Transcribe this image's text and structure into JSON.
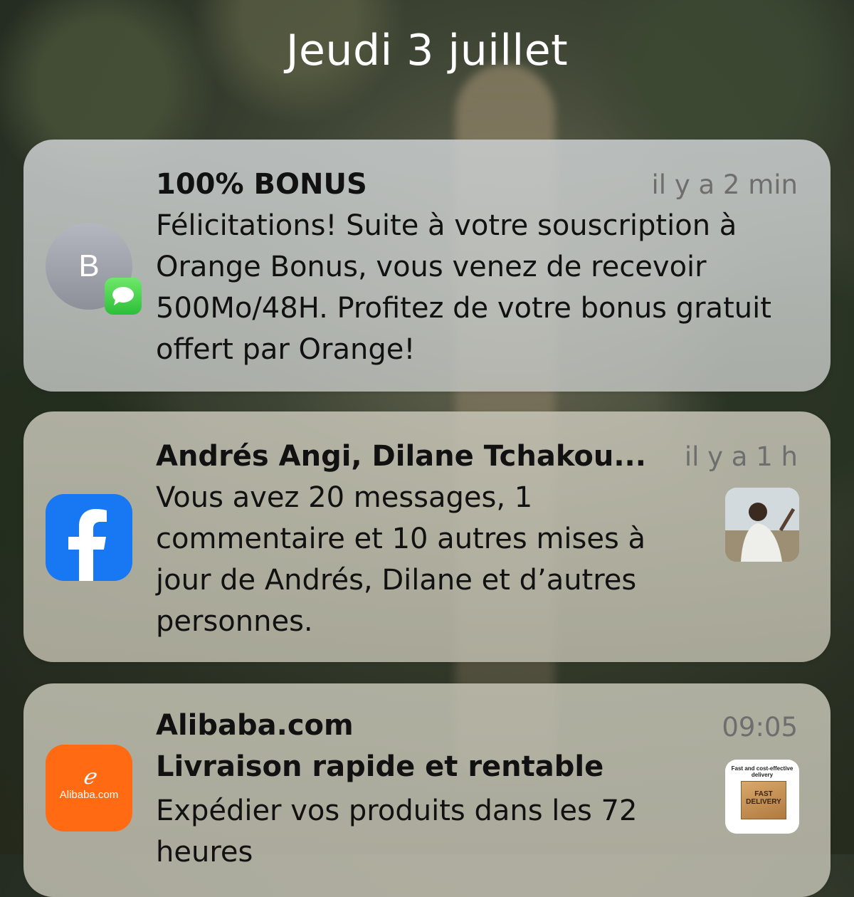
{
  "lockscreen": {
    "date": "Jeudi 3 juillet"
  },
  "notifications": [
    {
      "app": "Messages",
      "avatar_letter": "B",
      "title": "100% BONUS",
      "time": "il y a 2 min",
      "body": "Félicitations! Suite à votre souscription à Orange Bonus, vous venez de recevoir 500Mo/48H. Profitez de votre bonus gratuit offert par Orange!",
      "icon": "message-bubble-icon"
    },
    {
      "app": "Facebook",
      "title": "Andrés Angi, Dilane Tchakou...",
      "time": "il y a 1 h",
      "body": "Vous avez 20 messages, 1 commentaire et 10 autres mises à jour de Andrés, Dilane et d’autres personnes.",
      "icon": "facebook-icon",
      "thumbnail": "profile-photo"
    },
    {
      "app": "Alibaba.com",
      "title": "Alibaba.com",
      "subtitle": "Livraison rapide et rentable",
      "time": "09:05",
      "body": "Expédier vos produits dans les 72 heures",
      "icon": "alibaba-icon",
      "icon_text": "Alibaba.com",
      "thumbnail_caption": "Fast and cost-effective delivery",
      "thumbnail_box_label": "FAST DELIVERY"
    }
  ],
  "colors": {
    "facebook": "#1877f2",
    "alibaba": "#ff6a12",
    "messages": "#34c759"
  }
}
